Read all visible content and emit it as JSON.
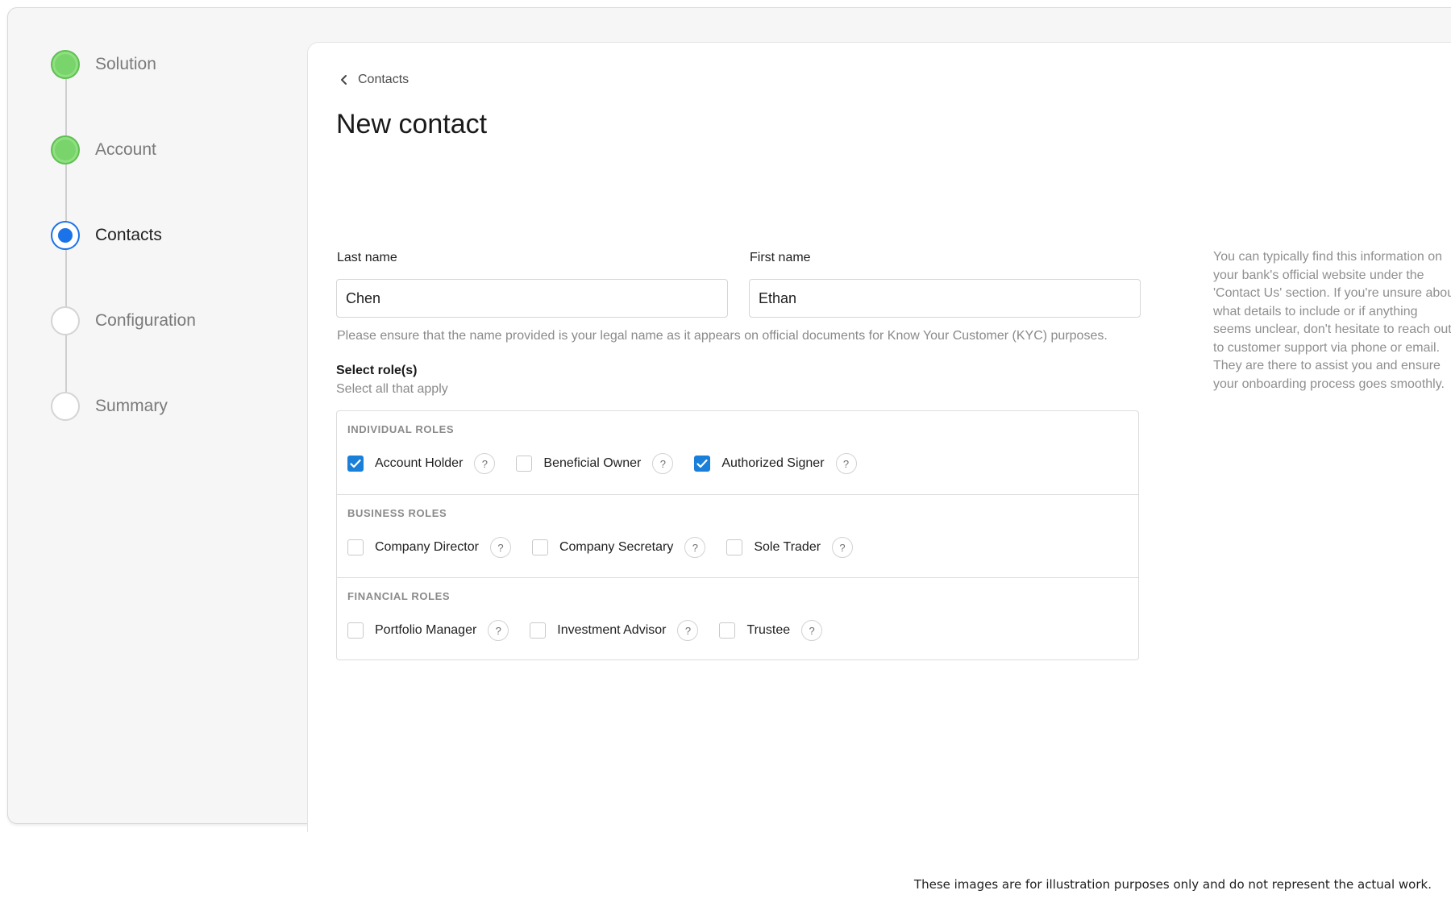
{
  "stepper": {
    "steps": [
      {
        "label": "Solution",
        "state": "done"
      },
      {
        "label": "Account",
        "state": "done"
      },
      {
        "label": "Contacts",
        "state": "current"
      },
      {
        "label": "Configuration",
        "state": "todo"
      },
      {
        "label": "Summary",
        "state": "todo"
      }
    ]
  },
  "breadcrumb": {
    "label": "Contacts",
    "icon": "chevron-left-icon"
  },
  "page": {
    "title": "New contact"
  },
  "form": {
    "last_name": {
      "label": "Last name",
      "value": "Chen"
    },
    "first_name": {
      "label": "First name",
      "value": "Ethan"
    },
    "name_hint": "Please ensure that the name provided is your legal name as it appears on official documents for Know Your Customer (KYC) purposes."
  },
  "roles": {
    "title": "Select role(s)",
    "subtitle": "Select all that apply",
    "help_glyph": "?",
    "sections": [
      {
        "title": "INDIVIDUAL ROLES",
        "items": [
          {
            "label": "Account Holder",
            "checked": true
          },
          {
            "label": "Beneficial Owner",
            "checked": false
          },
          {
            "label": "Authorized Signer",
            "checked": true
          }
        ]
      },
      {
        "title": "BUSINESS ROLES",
        "items": [
          {
            "label": "Company Director",
            "checked": false
          },
          {
            "label": "Company Secretary",
            "checked": false
          },
          {
            "label": "Sole Trader",
            "checked": false
          }
        ]
      },
      {
        "title": "FINANCIAL ROLES",
        "items": [
          {
            "label": "Portfolio Manager",
            "checked": false
          },
          {
            "label": "Investment Advisor",
            "checked": false
          },
          {
            "label": "Trustee",
            "checked": false
          }
        ]
      }
    ]
  },
  "side_help": "You can typically find this information on your bank's official website under the 'Contact Us' section. If you're unsure about what details to include or if anything seems unclear, don't hesitate to reach out to customer support via phone or email. They are there to assist you and ensure your onboarding process goes smoothly.",
  "disclaimer": "These images are for illustration purposes only and do not represent the actual work.",
  "colors": {
    "accent": "#1a7fd8",
    "step_done": "#79d46b",
    "step_current": "#1a73e8"
  }
}
